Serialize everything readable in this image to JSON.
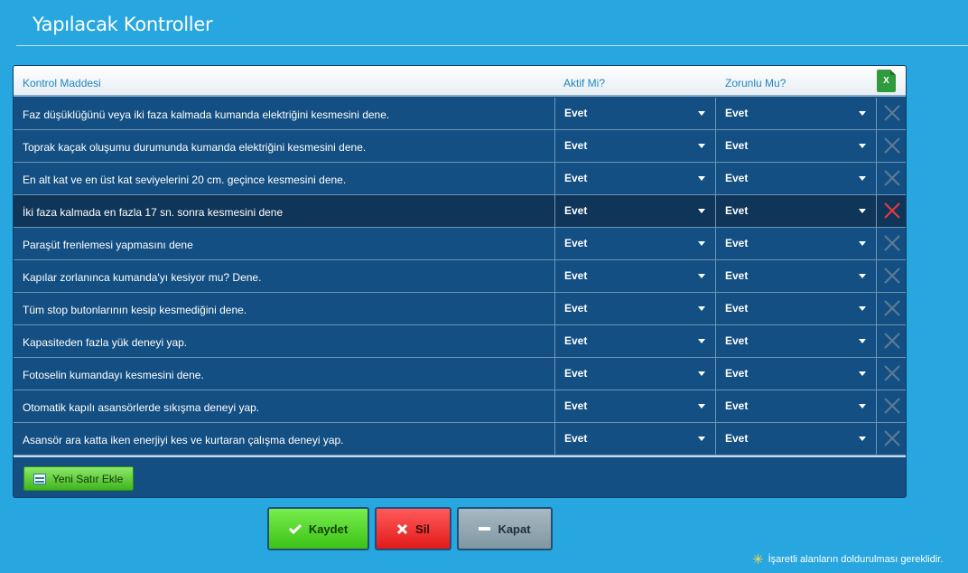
{
  "page": {
    "title": "Yapılacak Kontroller"
  },
  "grid": {
    "headers": {
      "item": "Kontrol Maddesi",
      "active": "Aktif Mi?",
      "required": "Zorunlu Mu?",
      "excel": "X"
    },
    "rows": [
      {
        "item": "Faz düşüklüğünü veya iki faza kalmada kumanda elektriğini kesmesini dene.",
        "active": "Evet",
        "required": "Evet"
      },
      {
        "item": "Toprak kaçak oluşumu durumunda kumanda elektriğini kesmesini dene.",
        "active": "Evet",
        "required": "Evet"
      },
      {
        "item": "En alt kat ve en üst kat seviyelerini 20 cm. geçince kesmesini dene.",
        "active": "Evet",
        "required": "Evet"
      },
      {
        "item": "İki faza kalmada en fazla 17 sn. sonra kesmesini dene",
        "active": "Evet",
        "required": "Evet"
      },
      {
        "item": "Paraşüt frenlemesi yapmasını dene",
        "active": "Evet",
        "required": "Evet"
      },
      {
        "item": "Kapılar zorlanınca kumanda'yı kesiyor mu? Dene.",
        "active": "Evet",
        "required": "Evet"
      },
      {
        "item": "Tüm stop butonlarının kesip kesmediğini dene.",
        "active": "Evet",
        "required": "Evet"
      },
      {
        "item": "Kapasiteden fazla yük deneyi yap.",
        "active": "Evet",
        "required": "Evet"
      },
      {
        "item": "Fotoselin kumandayı kesmesini dene.",
        "active": "Evet",
        "required": "Evet"
      },
      {
        "item": "Otomatik kapılı asansörlerde sıkışma deneyi yap.",
        "active": "Evet",
        "required": "Evet"
      },
      {
        "item": "Asansör ara katta iken enerjiyi kes ve kurtaran çalışma deneyi yap.",
        "active": "Evet",
        "required": "Evet"
      }
    ],
    "add_row_label": "Yeni Satır Ekle"
  },
  "actions": {
    "save": "Kaydet",
    "delete": "Sil",
    "close": "Kapat"
  },
  "note": "İşaretli alanların doldurulması gereklidir.",
  "colors": {
    "background": "#27a6e0",
    "grid": "#134f82",
    "active_row": "#0f3558",
    "delete_icon": "#5b7a95",
    "delete_icon_active": "#e23b3b"
  },
  "active_row_index": 3
}
